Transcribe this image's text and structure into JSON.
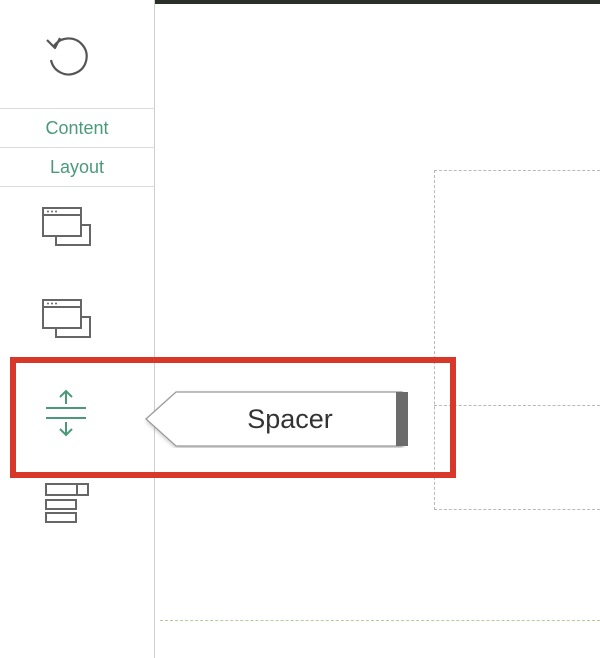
{
  "sidebar": {
    "tabs": [
      {
        "label": "Content"
      },
      {
        "label": "Layout"
      }
    ],
    "items": [
      {
        "icon": "window-stack-icon"
      },
      {
        "icon": "window-stack-icon"
      },
      {
        "icon": "spacer-icon"
      },
      {
        "icon": "list-layout-icon"
      }
    ]
  },
  "tooltip": {
    "label": "Spacer"
  },
  "colors": {
    "accent": "#4a9a7a",
    "highlight": "#d8382a",
    "topbar": "#2b2f2a"
  }
}
